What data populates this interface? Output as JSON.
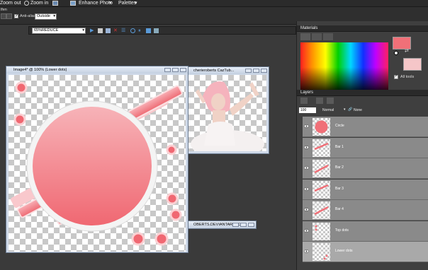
{
  "menu": {
    "zoom_out": "Zoom out",
    "zoom_in": "Zoom in",
    "enhance_photo": "Enhance Photo",
    "palettes": "Palettes",
    "tool_label": "lfen",
    "anti_alias": "Anti-alias",
    "outside_value": "Outside"
  },
  "script": {
    "name": "65%REDUCE"
  },
  "image_window": {
    "title": "Image4* @ 100% (Lower dots)"
  },
  "tube_window": {
    "title": "cherieroberts CazTub..."
  },
  "watermark_window": {
    "title": "OBERTS.DEVIANTART.COM"
  },
  "materials": {
    "title": "Materials",
    "all_tools_label": "All tools",
    "foreground_color": "#f07078",
    "background_color": "#f5c6c8"
  },
  "layers": {
    "title": "Layers",
    "opacity": "100",
    "blend_mode": "Normal",
    "none_label": "None",
    "items": [
      {
        "name": "Circle"
      },
      {
        "name": "Bar 1"
      },
      {
        "name": "Bar 2"
      },
      {
        "name": "Bar 3"
      },
      {
        "name": "Bar 4"
      },
      {
        "name": "Top dots"
      },
      {
        "name": "Lower dots"
      }
    ]
  },
  "colors": {
    "accent_pink": "#f07078",
    "light_pink": "#f7b6bb",
    "panel_bg": "#3f3f3f"
  }
}
